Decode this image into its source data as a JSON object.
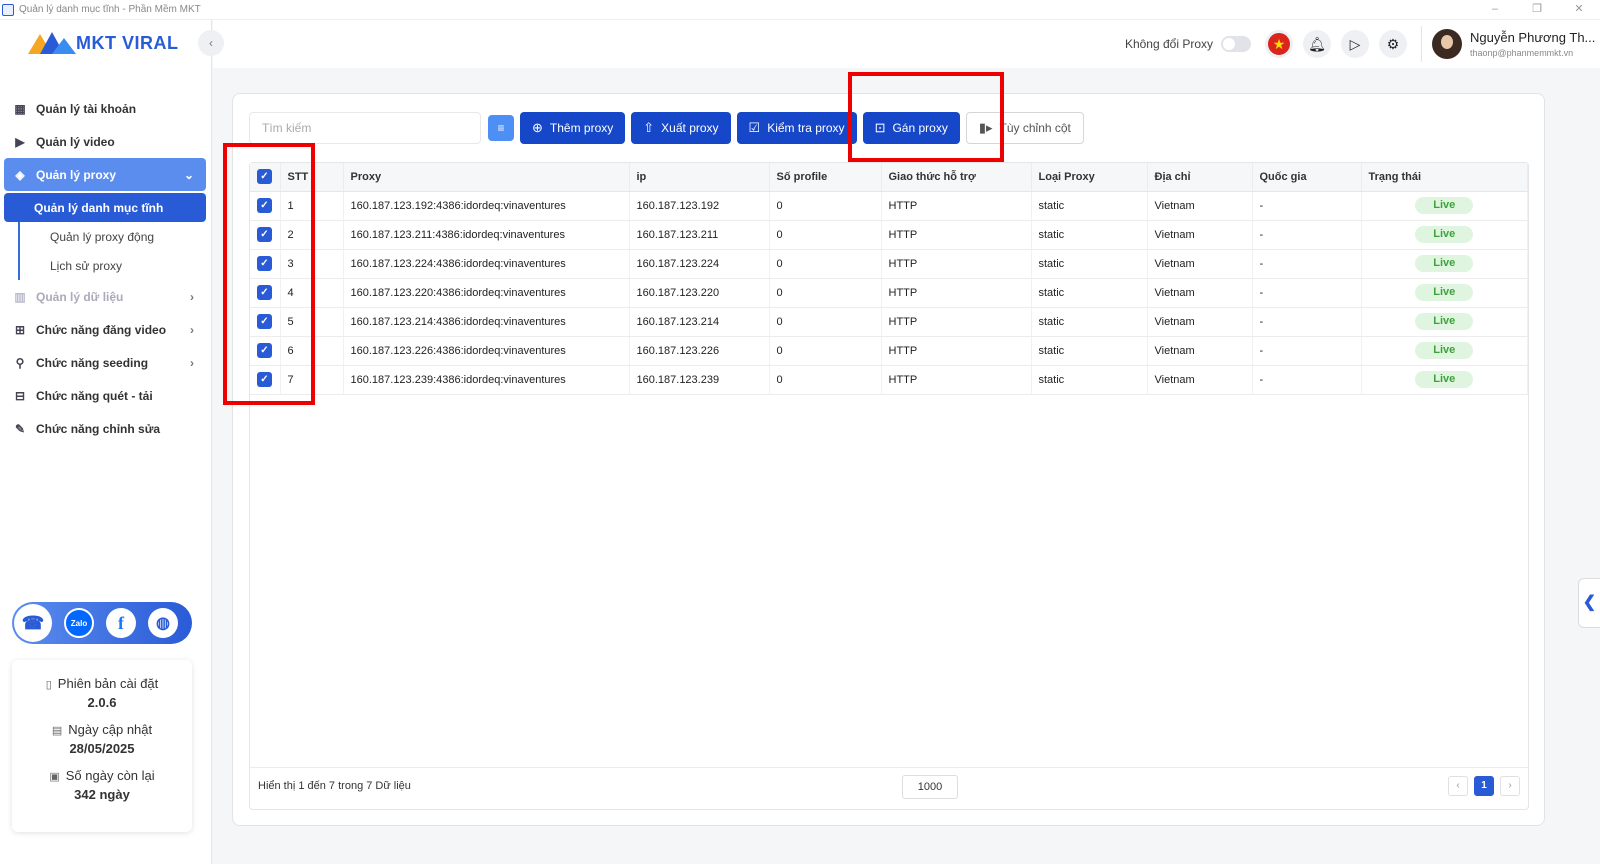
{
  "window": {
    "title": "Quản lý danh mục tĩnh - Phần Mềm MKT",
    "controls": [
      "–",
      "❐",
      "✕"
    ]
  },
  "brand": {
    "logo_text": "MKT VIRAL"
  },
  "sidebar": {
    "items": [
      {
        "label": "Quản lý tài khoản",
        "icon": "grid-icon"
      },
      {
        "label": "Quản lý video",
        "icon": "video-icon"
      },
      {
        "label": "Quản lý proxy",
        "icon": "layers-icon",
        "active": true
      },
      {
        "label": "Quản lý dữ liệu",
        "icon": "chart-icon",
        "disabled": true
      },
      {
        "label": "Chức năng đăng video",
        "icon": "upload-icon"
      },
      {
        "label": "Chức năng seeding",
        "icon": "seeding-icon"
      },
      {
        "label": "Chức năng quét - tải",
        "icon": "download-icon"
      },
      {
        "label": "Chức năng chỉnh sửa",
        "icon": "edit-icon"
      }
    ],
    "proxy_sub": [
      {
        "label": "Quản lý danh mục tĩnh",
        "active": true
      },
      {
        "label": "Quản lý proxy động"
      },
      {
        "label": "Lịch sử proxy"
      }
    ],
    "social": {
      "zalo": "Zalo",
      "facebook": "f"
    },
    "info": {
      "version_label": "Phiên bản cài đặt",
      "version": "2.0.6",
      "update_label": "Ngày cập nhật",
      "update_date": "28/05/2025",
      "days_label": "Số ngày còn lại",
      "days_left": "342 ngày"
    }
  },
  "header": {
    "proxy_toggle_label": "Không đổi Proxy",
    "user_name": "Nguyễn Phương Th...",
    "user_email": "thaonp@phanmemmkt.vn"
  },
  "toolbar": {
    "search_placeholder": "Tìm kiếm",
    "add_proxy": "Thêm proxy",
    "export_proxy": "Xuất proxy",
    "check_proxy": "Kiểm tra proxy",
    "assign_proxy": "Gán proxy",
    "custom_columns": "Tùy chỉnh cột"
  },
  "table": {
    "headers": [
      "STT",
      "Proxy",
      "ip",
      "Số profile",
      "Giao thức hỗ trợ",
      "Loại Proxy",
      "Địa chỉ",
      "Quốc gia",
      "Trạng thái"
    ],
    "rows": [
      {
        "stt": "1",
        "proxy": "160.187.123.192:4386:idordeq:vinaventures",
        "ip": "160.187.123.192",
        "profiles": "0",
        "protocol": "HTTP",
        "type": "static",
        "address": "Vietnam",
        "country": "-",
        "status": "Live"
      },
      {
        "stt": "2",
        "proxy": "160.187.123.211:4386:idordeq:vinaventures",
        "ip": "160.187.123.211",
        "profiles": "0",
        "protocol": "HTTP",
        "type": "static",
        "address": "Vietnam",
        "country": "-",
        "status": "Live"
      },
      {
        "stt": "3",
        "proxy": "160.187.123.224:4386:idordeq:vinaventures",
        "ip": "160.187.123.224",
        "profiles": "0",
        "protocol": "HTTP",
        "type": "static",
        "address": "Vietnam",
        "country": "-",
        "status": "Live"
      },
      {
        "stt": "4",
        "proxy": "160.187.123.220:4386:idordeq:vinaventures",
        "ip": "160.187.123.220",
        "profiles": "0",
        "protocol": "HTTP",
        "type": "static",
        "address": "Vietnam",
        "country": "-",
        "status": "Live"
      },
      {
        "stt": "5",
        "proxy": "160.187.123.214:4386:idordeq:vinaventures",
        "ip": "160.187.123.214",
        "profiles": "0",
        "protocol": "HTTP",
        "type": "static",
        "address": "Vietnam",
        "country": "-",
        "status": "Live"
      },
      {
        "stt": "6",
        "proxy": "160.187.123.226:4386:idordeq:vinaventures",
        "ip": "160.187.123.226",
        "profiles": "0",
        "protocol": "HTTP",
        "type": "static",
        "address": "Vietnam",
        "country": "-",
        "status": "Live"
      },
      {
        "stt": "7",
        "proxy": "160.187.123.239:4386:idordeq:vinaventures",
        "ip": "160.187.123.239",
        "profiles": "0",
        "protocol": "HTTP",
        "type": "static",
        "address": "Vietnam",
        "country": "-",
        "status": "Live"
      }
    ]
  },
  "footer": {
    "summary": "Hiển thị 1 đến 7 trong 7 Dữ liệu",
    "page_size": "1000",
    "current_page": "1"
  },
  "colors": {
    "primary": "#1747c9",
    "sidebar_active": "#5b8def",
    "live_bg": "#dff5df",
    "live_text": "#3ca33c",
    "highlight": "#ee0000"
  }
}
